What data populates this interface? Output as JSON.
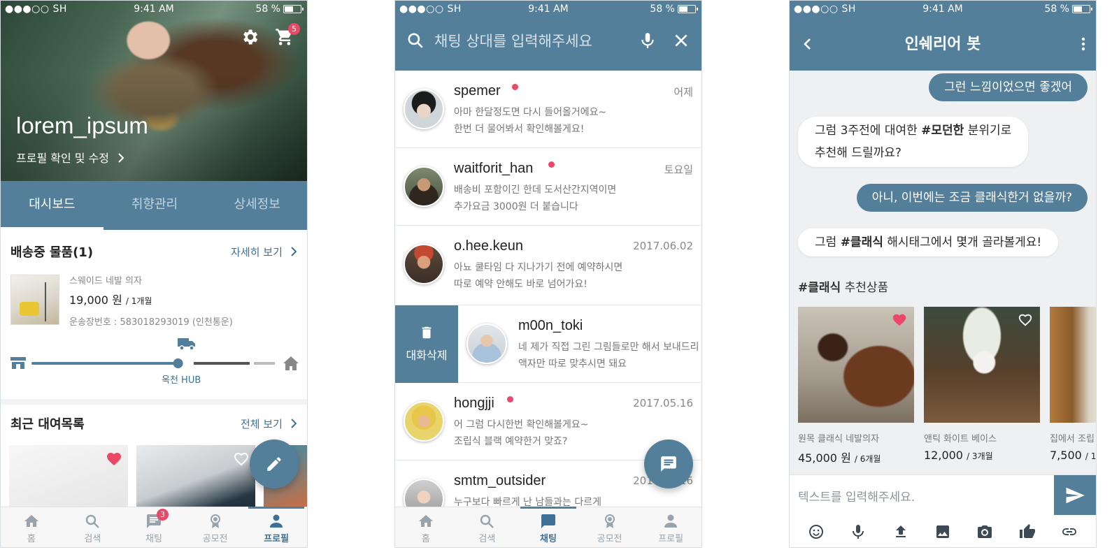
{
  "status": {
    "carrier": "●●●○○ SH",
    "time": "9:41 AM",
    "battery": "58 %",
    "battery_level": 0.58
  },
  "colors": {
    "primary": "#537f9b",
    "accent": "#e94867",
    "link": "#3d7296"
  },
  "profile_screen": {
    "cart_count": "5",
    "username": "lorem_ipsum",
    "edit_link": "프로필 확인 및 수정",
    "tabs": [
      {
        "label": "대시보드",
        "active": true
      },
      {
        "label": "취향관리",
        "active": false
      },
      {
        "label": "상세정보",
        "active": false
      }
    ],
    "shipping": {
      "title": "배송중 물품(1)",
      "more": "자세히 보기",
      "item_name": "스웨이드 네발 의자",
      "price": "19,000 원",
      "period": "/ 1개월",
      "tracking": "운송장번호 : 583018293019 (인천통운)",
      "hub": "옥천 HUB",
      "progress": 0.6
    },
    "rentals": {
      "title": "최근 대여목록",
      "more": "전체 보기"
    },
    "nav": [
      {
        "label": "홈",
        "icon": "home-icon"
      },
      {
        "label": "검색",
        "icon": "search-icon"
      },
      {
        "label": "채팅",
        "icon": "chat-icon",
        "badge": "3"
      },
      {
        "label": "공모전",
        "icon": "medal-icon"
      },
      {
        "label": "프로필",
        "icon": "person-icon",
        "active": true
      }
    ]
  },
  "chat_list_screen": {
    "search_placeholder": "채팅 상대를 입력해주세요",
    "delete_label": "대화삭제",
    "chats": [
      {
        "name": "spemer",
        "when": "어제",
        "unread": true,
        "line1": "아마 한달정도면 다시 들어올거에요~",
        "line2": "한번 더 물어봐서 확인해볼게요!"
      },
      {
        "name": "waitforit_han",
        "when": "토요일",
        "unread": true,
        "line1": "배송비 포함이긴 한데 도서산간지역이면",
        "line2": "추가요금 3000원 더 붙습니다"
      },
      {
        "name": "o.hee.keun",
        "when": "2017.06.02",
        "unread": false,
        "line1": "아뇨 쿨타임 다 지나가기 전에 예약하시면",
        "line2": "따로 예약 안해도 바로 넘어가요!"
      },
      {
        "name": "m00n_toki",
        "when": "",
        "unread": false,
        "line1": "네 제가 직접 그린 그림들로만 해서 보내드리",
        "line2": "액자만 따로 맞추시면 돼요"
      },
      {
        "name": "hongjji",
        "when": "2017.05.16",
        "unread": true,
        "line1": "어 그럼 다시한번 확인해볼게요~",
        "line2": "조립식 블랙 예약한거 맞죠?"
      },
      {
        "name": "smtm_outsider",
        "when": "2017.05.16",
        "unread": false,
        "line1": "누구보다 빠르게 난 남들과는 다르게",
        "line2": ""
      }
    ],
    "nav": [
      {
        "label": "홈",
        "icon": "home-icon"
      },
      {
        "label": "검색",
        "icon": "search-icon"
      },
      {
        "label": "채팅",
        "icon": "chat-icon",
        "active": true
      },
      {
        "label": "공모전",
        "icon": "medal-icon"
      },
      {
        "label": "프로필",
        "icon": "person-icon"
      }
    ]
  },
  "bot_screen": {
    "title": "인쉐리어 봇",
    "msg1": "그런 느낌이었으면 좋겠어",
    "msg2_pre": "그럼 3주전에 대여한 ",
    "msg2_tag": "#모던한",
    "msg2_post": " 분위기로",
    "msg2_line2": "추천해 드릴까요?",
    "msg3": "아니, 이번에는 조금 클래식한거 없을까?",
    "msg4_pre": "그럼 ",
    "msg4_tag": "#클래식",
    "msg4_post": " 해시태그에서 몇개 골라볼게요!",
    "reco_tag": "#클래식",
    "reco_label": " 추천상품",
    "products": [
      {
        "name": "원목 클래식 네발의자",
        "price": "45,000 원",
        "period": "/ 6개월",
        "liked": true
      },
      {
        "name": "앤틱 화이트 베이스",
        "price": "12,000",
        "period": "/ 3개월",
        "liked": false
      },
      {
        "name": "집에서 조립",
        "price": "7,500",
        "period": "/ 1",
        "liked": false
      }
    ],
    "input_placeholder": "텍스트를 입력해주세요.",
    "tools": [
      "smile-icon",
      "mic-icon",
      "upload-icon",
      "image-icon",
      "camera-icon",
      "thumbs-up-icon",
      "link-icon"
    ]
  }
}
